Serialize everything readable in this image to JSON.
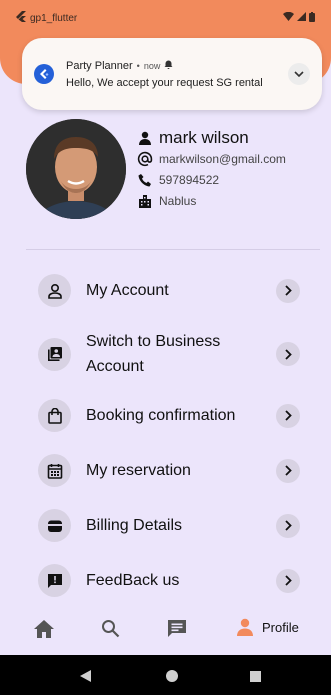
{
  "status_bar": {
    "app_name": "gp1_flutter"
  },
  "notification": {
    "app": "Party Planner",
    "time": "now",
    "message": "Hello, We accept your request SG rental"
  },
  "profile": {
    "name": "mark wilson",
    "email": "markwilson@gmail.com",
    "phone": "597894522",
    "city": "Nablus"
  },
  "menu": {
    "items": [
      {
        "label": "My Account",
        "icon": "person-outline-icon"
      },
      {
        "label": "Switch to Business Account",
        "icon": "business-card-icon"
      },
      {
        "label": "Booking confirmation",
        "icon": "shopping-bag-icon"
      },
      {
        "label": "My reservation",
        "icon": "calendar-icon"
      },
      {
        "label": "Billing Details",
        "icon": "wallet-icon"
      },
      {
        "label": "FeedBack us",
        "icon": "feedback-icon"
      }
    ]
  },
  "bottom_nav": {
    "items": [
      "home-icon",
      "search-icon",
      "chat-icon",
      "profile-icon"
    ],
    "active_label": "Profile",
    "active_color": "#f28a5c"
  },
  "colors": {
    "accent": "#f28a5c",
    "background": "#ece5fb",
    "chip": "#d8d2e3",
    "notification_icon": "#2460d8"
  }
}
